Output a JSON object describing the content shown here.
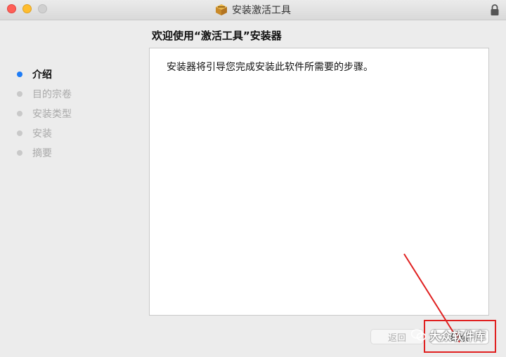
{
  "window": {
    "title": "安装激活工具"
  },
  "header": {
    "title": "欢迎使用“激活工具”安装器"
  },
  "sidebar": {
    "steps": [
      {
        "label": "介绍",
        "active": true
      },
      {
        "label": "目的宗卷",
        "active": false
      },
      {
        "label": "安装类型",
        "active": false
      },
      {
        "label": "安装",
        "active": false
      },
      {
        "label": "摘要",
        "active": false
      }
    ]
  },
  "content": {
    "text": "安装器将引导您完成安装此软件所需要的步骤。"
  },
  "buttons": {
    "back": "返回",
    "continue": "继续"
  },
  "watermark": {
    "text": "大众软件库"
  },
  "colors": {
    "active_step": "#1e7cf6",
    "annotation": "#e02020"
  }
}
